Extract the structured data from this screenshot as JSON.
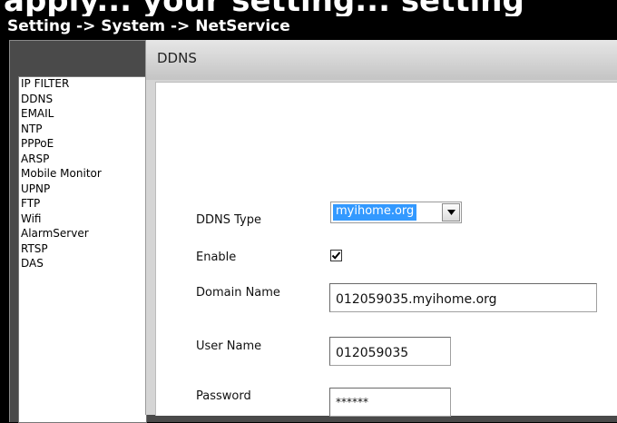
{
  "page": {
    "top_banner_text": "apply... your setting... setting",
    "breadcrumb": "Setting -> System -> NetService"
  },
  "menu": {
    "items": [
      "IP FILTER",
      "DDNS",
      "EMAIL",
      "NTP",
      "PPPoE",
      "ARSP",
      "Mobile Monitor",
      "UPNP",
      "FTP",
      "Wifi",
      "AlarmServer",
      "RTSP",
      "DAS"
    ]
  },
  "dialog": {
    "title": "DDNS",
    "fields": {
      "ddns_type": {
        "label": "DDNS Type",
        "value": "myihome.org"
      },
      "enable": {
        "label": "Enable",
        "checked": true
      },
      "domain_name": {
        "label": "Domain Name",
        "value": "012059035.myihome.org"
      },
      "user_name": {
        "label": "User Name",
        "value": "012059035"
      },
      "password": {
        "label": "Password",
        "value": "******"
      }
    }
  },
  "colors": {
    "selection": "#3399ff",
    "background": "#000000"
  },
  "icons": {
    "dropdown": "chevron-down-icon",
    "check": "check-icon"
  }
}
